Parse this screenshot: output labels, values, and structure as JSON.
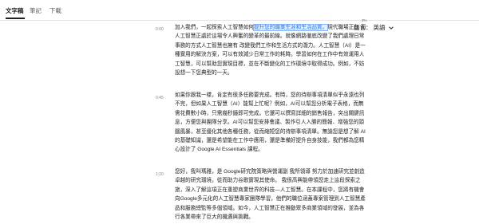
{
  "tabs": [
    "文字稿",
    "筆記",
    "下載"
  ],
  "zoom_badge": "3%",
  "language": {
    "label": "語言：",
    "value": "英語"
  },
  "transcript": [
    {
      "time": "0:00",
      "before": "加入我們，一起探索人工智慧如何",
      "highlight": "提升您的職業生涯和生活品質。",
      "after": "現代職場正在 而人工智慧正處於這場令人興奮的變革的最前線。就像網路徹底改變了我們處理日常事務的方式人工智慧也擁有 改變我們工作和生活方式的潛力。人工智慧（AI）是一種實用的解決方案，可以有效減少日常工作的耗時。學習如何在工作中有效運用人工智慧，可以幫助您實現目標，並在不斷變化的工作環境中取得成功。例如，不妨設想一下您典型的一天。"
    },
    {
      "time": "0:45",
      "text": "如果你跟我一樣，肯定有很多任務要完成。有時，您的待辦事項清單似乎永遠也列不完，但如果人工智慧（AI）能幫上忙呢？例如，AI可以幫您分析電子表格，而無需花費數小時，只需幾秒鐘即可完成。它還可以撰寫詳細的銷售報告，突出關鍵訊息，方便您與團隊分享。AI可以幫您安排會議、製作引人入勝的簡報、增強您的頭腦風暴，甚至優化其他各種任務，從而縮短您的待辦事項清單。無論您是想了解 AI 的基礎知識，還是希望能在工作中應用，還是準備好提升自身技能，我們都為您精心設計了 Google AI Essentials 課程。"
    },
    {
      "time": "1:20",
      "text": "您好，我叫瑪雅，是 Google研究院策略與營運副 我所領導 努力於加速研究並創造卓越的研究環境，從而助力谷歌實現其使命。 我很高興能帶領您走上這段探索之旅，深入了解這項正在重塑商業世界的科技—人工智慧。在本課程中，您將有機會向Google多元化的人工智慧專家團隊學習，他們的職位涵蓋專案管理到人工智慧產品和服務總監等多個領域。如今，人工智慧正在推動眾多商業領域的發展，並為各行各業帶來了巨大的機遇與挑戰。"
    }
  ]
}
